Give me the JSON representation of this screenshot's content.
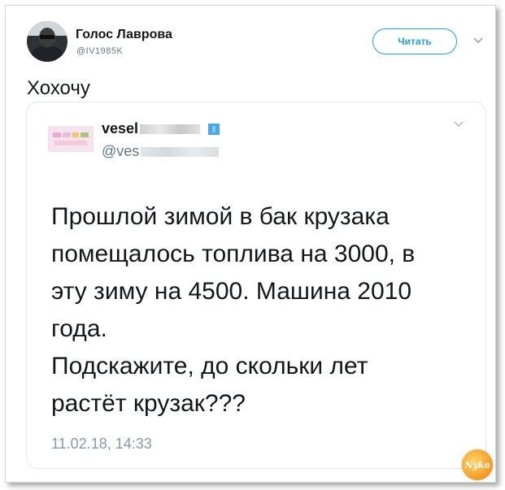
{
  "author": {
    "name": "Голос Лаврова",
    "handle": "@IV1985K"
  },
  "follow_label": "Читать",
  "tweet_text": "Хохочу",
  "quoted": {
    "name_visible": "vesel",
    "handle_visible": "@ves",
    "body": "Прошлой зимой в бак крузака\nпомещалось топлива на 3000, в\nэту зиму на 4500. Машина 2010\nгода.\nПодскажите, до скольки лет\nрастёт крузак???",
    "date": "11.02.18, 14:33"
  },
  "watermark": "Nyka",
  "colors": {
    "accent": "#1da1f2",
    "text": "#14171a",
    "muted": "#657786"
  },
  "icons": [
    "avatar-image",
    "chevron-down-icon",
    "verified-icon",
    "watermark-logo"
  ]
}
